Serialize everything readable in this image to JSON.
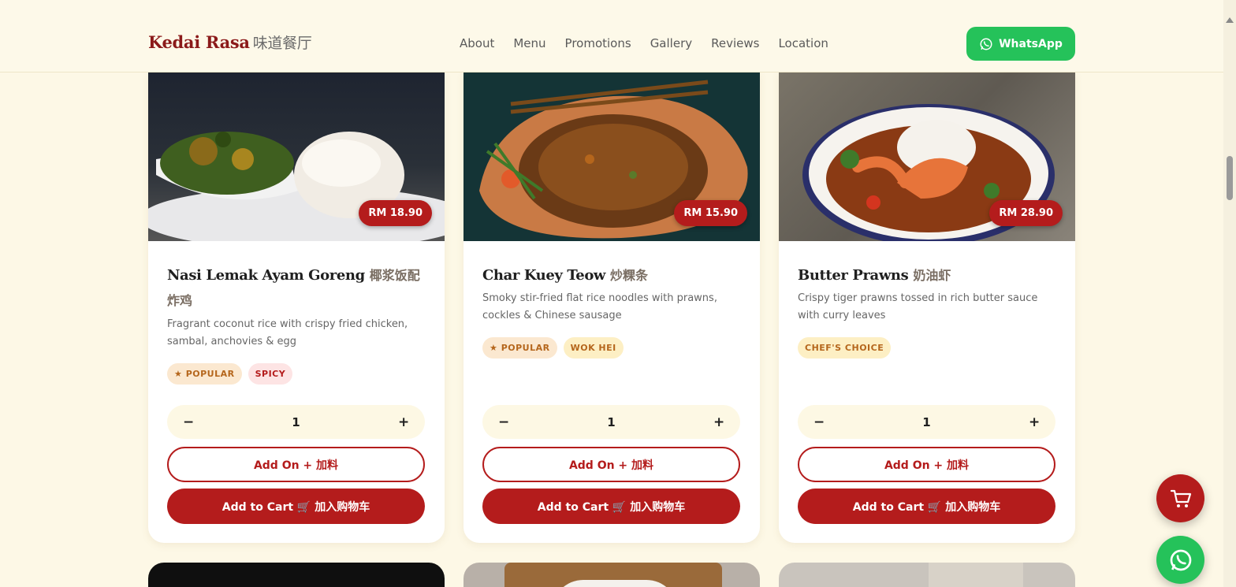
{
  "brand": {
    "name": "Kedai Rasa",
    "zh": "味道餐厅"
  },
  "nav": [
    "About",
    "Menu",
    "Promotions",
    "Gallery",
    "Reviews",
    "Location"
  ],
  "whatsapp_label": "WhatsApp",
  "cards": [
    {
      "price": "RM 18.90",
      "title_en": "Nasi Lemak Ayam Goreng",
      "title_zh": "椰浆饭配炸鸡",
      "desc": "Fragrant coconut rice with crispy fried chicken, sambal, anchovies & egg",
      "tags": [
        "★ POPULAR",
        "SPICY"
      ],
      "qty": "1",
      "minus": "−",
      "plus": "+",
      "addon": "Add On + 加料",
      "add_to_cart": "Add to Cart 🛒 加入购物车"
    },
    {
      "price": "RM 15.90",
      "title_en": "Char Kuey Teow",
      "title_zh": "炒粿条",
      "desc": "Smoky stir-fried flat rice noodles with prawns, cockles & Chinese sausage",
      "tags": [
        "★ POPULAR",
        "WOK HEI"
      ],
      "qty": "1",
      "minus": "−",
      "plus": "+",
      "addon": "Add On + 加料",
      "add_to_cart": "Add to Cart 🛒 加入购物车"
    },
    {
      "price": "RM 28.90",
      "title_en": "Butter Prawns",
      "title_zh": "奶油虾",
      "desc": "Crispy tiger prawns tossed in rich butter sauce with curry leaves",
      "tags": [
        "CHEF'S CHOICE"
      ],
      "qty": "1",
      "minus": "−",
      "plus": "+",
      "addon": "Add On + 加料",
      "add_to_cart": "Add to Cart 🛒 加入购物车"
    }
  ],
  "colors": {
    "brand": "#8b1a1a",
    "accent": "#b41c1c",
    "whatsapp": "#25c25a",
    "background": "#fdf8e6"
  },
  "icons": {
    "whatsapp": "whatsapp-icon",
    "cart": "cart-icon"
  }
}
